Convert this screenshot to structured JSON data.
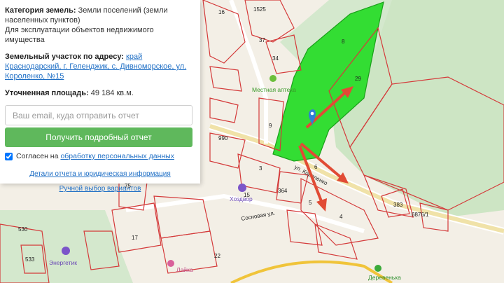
{
  "panel": {
    "category_label": "Категория земель:",
    "category_value": "Земли поселений (земли населенных пунктов)",
    "usage": "Для эксплуатации объектов недвижимого имущества",
    "address_label": "Земельный участок по адресу:",
    "address_value": "край Краснодарский, г. Геленджик, с. Дивноморское, ул. Короленко, №15",
    "area_label": "Уточненная площадь:",
    "area_value": "49 184 кв.м.",
    "email_placeholder": "Ваш email, куда отправить отчет",
    "submit_label": "Получить подробный отчет",
    "consent_text": "Согласен на",
    "consent_link": "обработку персональных данных",
    "details_link": "Детали отчета и юридическая информация",
    "manual_link": "Ручной выбор вариантов"
  },
  "map": {
    "colors": {
      "highlight": "#33dd33",
      "boundary": "#d43a3a",
      "arrow": "#e14b35",
      "pin": "#2f7fd6",
      "forest": "#cde5c4",
      "road": "#ffffff"
    },
    "poi": {
      "pharmacy": "Местная аптека",
      "store": "Хоздвор",
      "energy": "Энергетик",
      "village": "Деревенька",
      "shop": "Лайка"
    },
    "parcels": [
      "8",
      "29",
      "9",
      "3",
      "364",
      "4",
      "6",
      "383",
      "6876/1",
      "990",
      "75",
      "530",
      "533",
      "34",
      "1525",
      "16",
      "37",
      "15",
      "5",
      "22",
      "17"
    ],
    "streets": [
      "ул. Короленко",
      "Сосновая ул."
    ]
  }
}
